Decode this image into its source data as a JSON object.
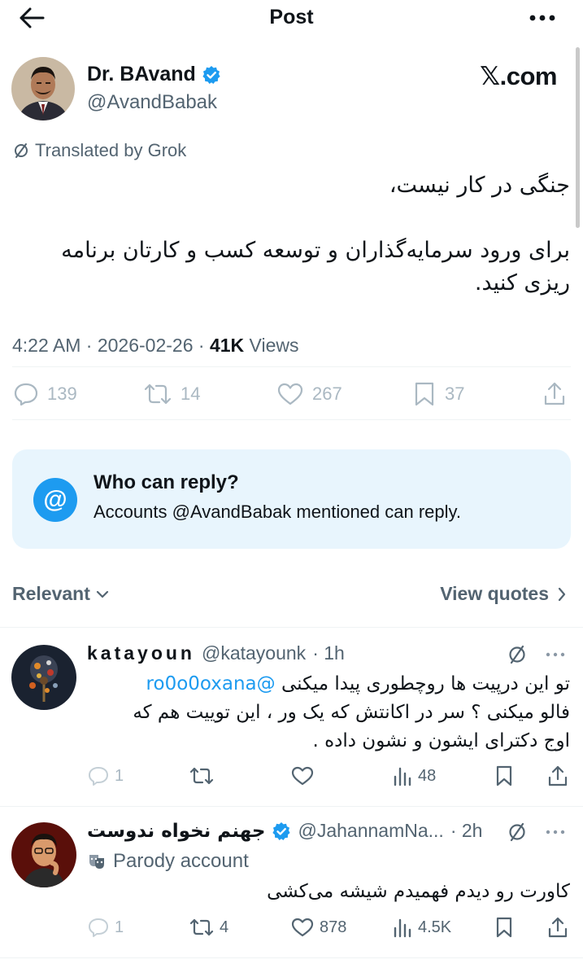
{
  "header": {
    "title": "Post"
  },
  "author": {
    "name": "Dr. BAvand",
    "handle": "@AvandBabak",
    "source": "𝕏.com"
  },
  "translated": "Translated by Grok",
  "post": {
    "line1": "جنگی در کار نیست،",
    "line2": "برای ورود سرمایه‌گذاران و توسعه کسب و کارتان برنامه ریزی کنید."
  },
  "meta": {
    "time": "4:22 AM",
    "date": "2026-02-26",
    "views_count": "41K",
    "views_label": "Views"
  },
  "stats": {
    "replies": "139",
    "reposts": "14",
    "likes": "267",
    "bookmarks": "37"
  },
  "reply_restriction": {
    "title": "Who can reply?",
    "subtitle": "Accounts @AvandBabak mentioned can reply."
  },
  "sort": {
    "label": "Relevant",
    "quotes_label": "View quotes"
  },
  "replies": [
    {
      "name": "katayoun",
      "handle": "@katayounk",
      "time": "· 1h",
      "mention": "@ro0o0oxana",
      "line1": "تو این درپیت ها روچطوری پیدا میکنی",
      "line2": "فالو میکنی ؟ سر در اکانتش که یک ور ، این توییت هم که",
      "line3": "اوج دکترای ایشون و نشون داده .",
      "replies": "1",
      "reposts": "",
      "likes": "",
      "views": "48"
    },
    {
      "name": "جهنم نخواه ندوست",
      "handle": "@JahannamNa...",
      "time": "· 2h",
      "badge": "Parody account",
      "line1": "کاورت رو دیدم فهمیدم شیشه می‌کشی",
      "replies": "1",
      "reposts": "4",
      "likes": "878",
      "views": "4.5K"
    }
  ],
  "colors": {
    "accent": "#1d9bf0",
    "text": "#0f1419",
    "secondary": "#536471",
    "muted": "#aab8c2",
    "reply_box_bg": "#e8f5fd"
  }
}
